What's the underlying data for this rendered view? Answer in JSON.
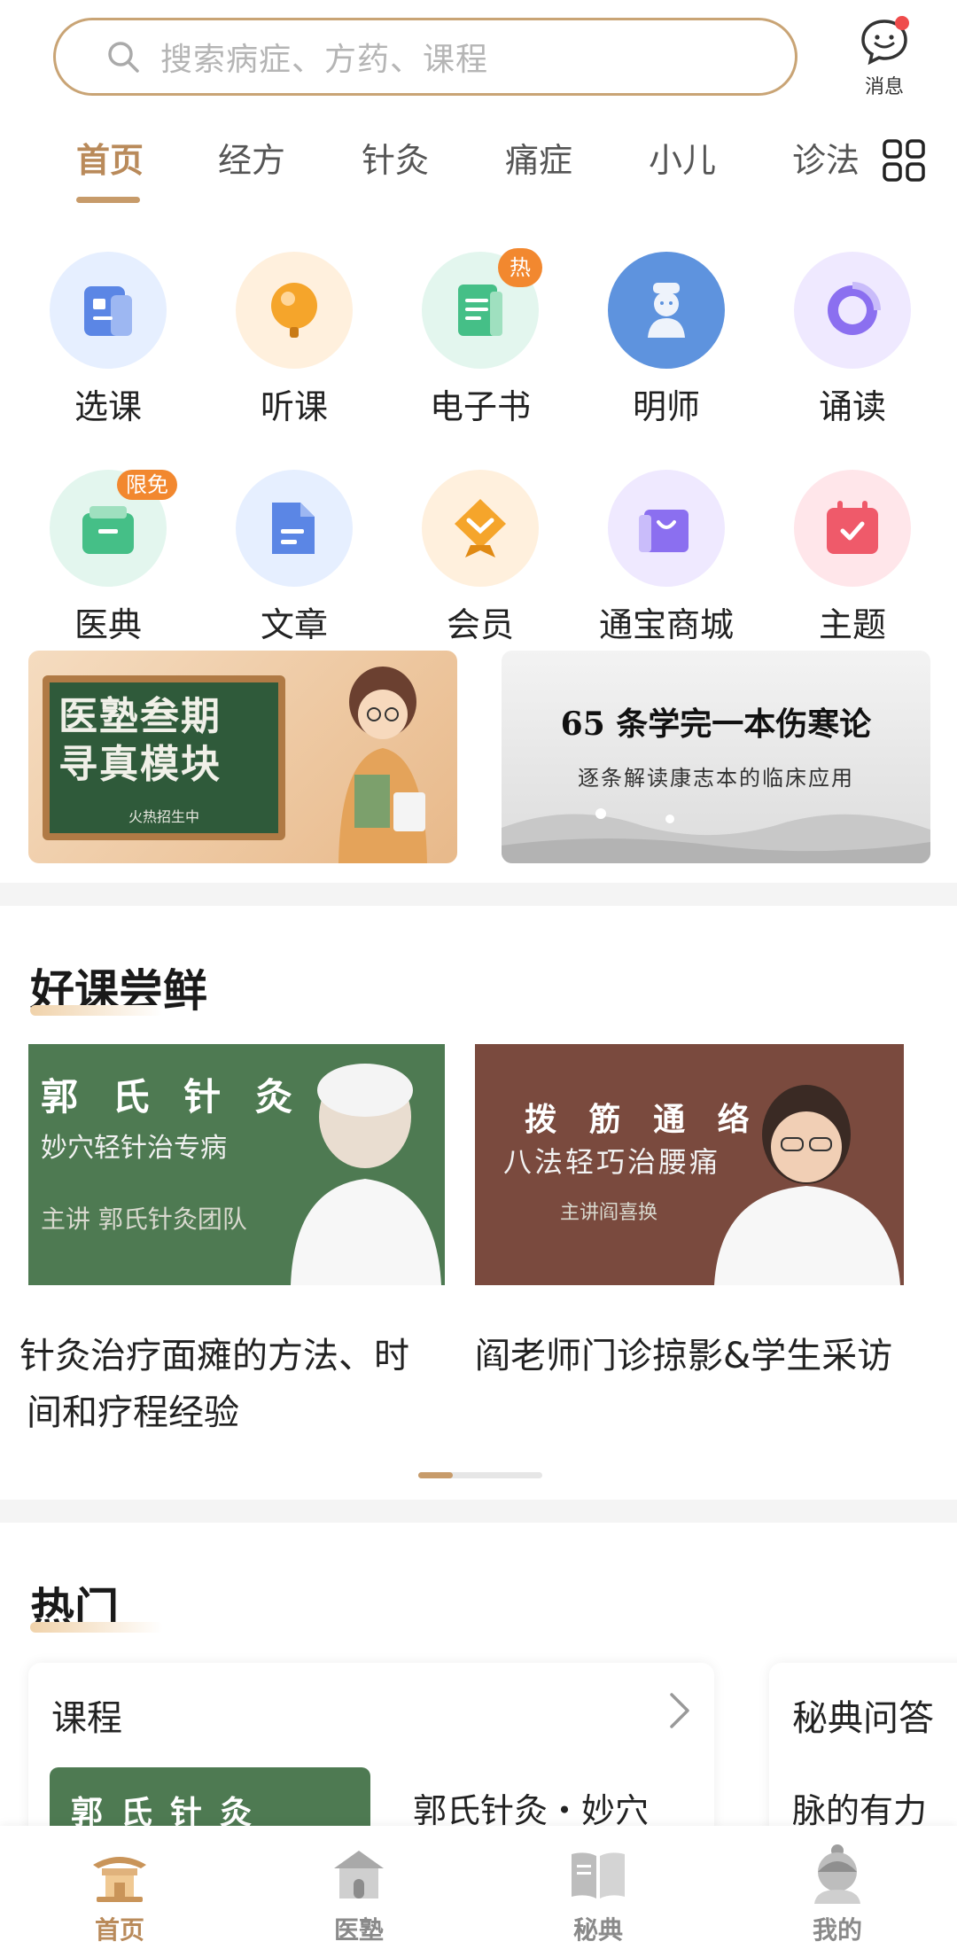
{
  "search": {
    "placeholder": "搜索病症、方药、课程"
  },
  "header": {
    "message_label": "消息"
  },
  "tabs": [
    {
      "label": "首页",
      "active": true
    },
    {
      "label": "经方"
    },
    {
      "label": "针灸"
    },
    {
      "label": "痛症"
    },
    {
      "label": "小儿"
    },
    {
      "label": "诊法"
    }
  ],
  "entries": [
    {
      "label": "选课",
      "icon": "course-select-icon"
    },
    {
      "label": "听课",
      "icon": "listen-icon"
    },
    {
      "label": "电子书",
      "icon": "ebook-icon",
      "badge": "热"
    },
    {
      "label": "明师",
      "icon": "teacher-icon"
    },
    {
      "label": "诵读",
      "icon": "recite-icon"
    },
    {
      "label": "医典",
      "icon": "classic-icon",
      "badge": "限免"
    },
    {
      "label": "文章",
      "icon": "article-icon"
    },
    {
      "label": "会员",
      "icon": "member-icon"
    },
    {
      "label": "通宝商城",
      "icon": "shop-icon"
    },
    {
      "label": "主题",
      "icon": "topic-icon"
    }
  ],
  "banners": {
    "left": {
      "title": "医塾叁期 寻真模块",
      "subtitle": "火热招生中"
    },
    "right": {
      "title": "65 条学完一本伤寒论",
      "subtitle": "逐条解读康志本的临床应用"
    }
  },
  "good_courses": {
    "title": "好课尝鲜",
    "items": [
      {
        "thumb_title": "郭 氏 针 灸",
        "thumb_sub": "妙穴轻针治专病",
        "thumb_lecturer": "主讲 郭氏针灸团队",
        "desc": "针灸治疗面瘫的方法、时间和疗程经验"
      },
      {
        "thumb_title": "拨 筋 通 络",
        "thumb_sub": "八法轻巧治腰痛",
        "thumb_lecturer": "主讲阎喜换",
        "desc": "阎老师门诊掠影&学生采访"
      }
    ],
    "page_progress": 0.28
  },
  "hot": {
    "title": "热门",
    "cards": [
      {
        "header": "课程",
        "thumb_text": "郭氏针灸",
        "item_title": "郭氏针灸・妙穴"
      },
      {
        "header": "秘典问答",
        "item_title": "脉的有力"
      }
    ]
  },
  "bottom_nav": [
    {
      "label": "首页",
      "active": true
    },
    {
      "label": "医塾"
    },
    {
      "label": "秘典"
    },
    {
      "label": "我的"
    }
  ],
  "colors": {
    "accent": "#c79b6a",
    "badge": "#f2882f",
    "search_border": "#c9a475"
  }
}
